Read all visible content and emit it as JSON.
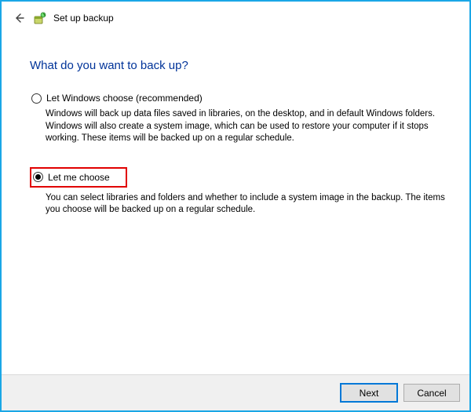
{
  "header": {
    "title": "Set up backup"
  },
  "page": {
    "heading": "What do you want to back up?"
  },
  "options": {
    "windows_choose": {
      "label": "Let Windows choose (recommended)",
      "desc": "Windows will back up data files saved in libraries, on the desktop, and in default Windows folders. Windows will also create a system image, which can be used to restore your computer if it stops working. These items will be backed up on a regular schedule.",
      "selected": false
    },
    "let_me_choose": {
      "label": "Let me choose",
      "desc": "You can select libraries and folders and whether to include a system image in the backup. The items you choose will be backed up on a regular schedule.",
      "selected": true
    }
  },
  "footer": {
    "next": "Next",
    "cancel": "Cancel"
  }
}
